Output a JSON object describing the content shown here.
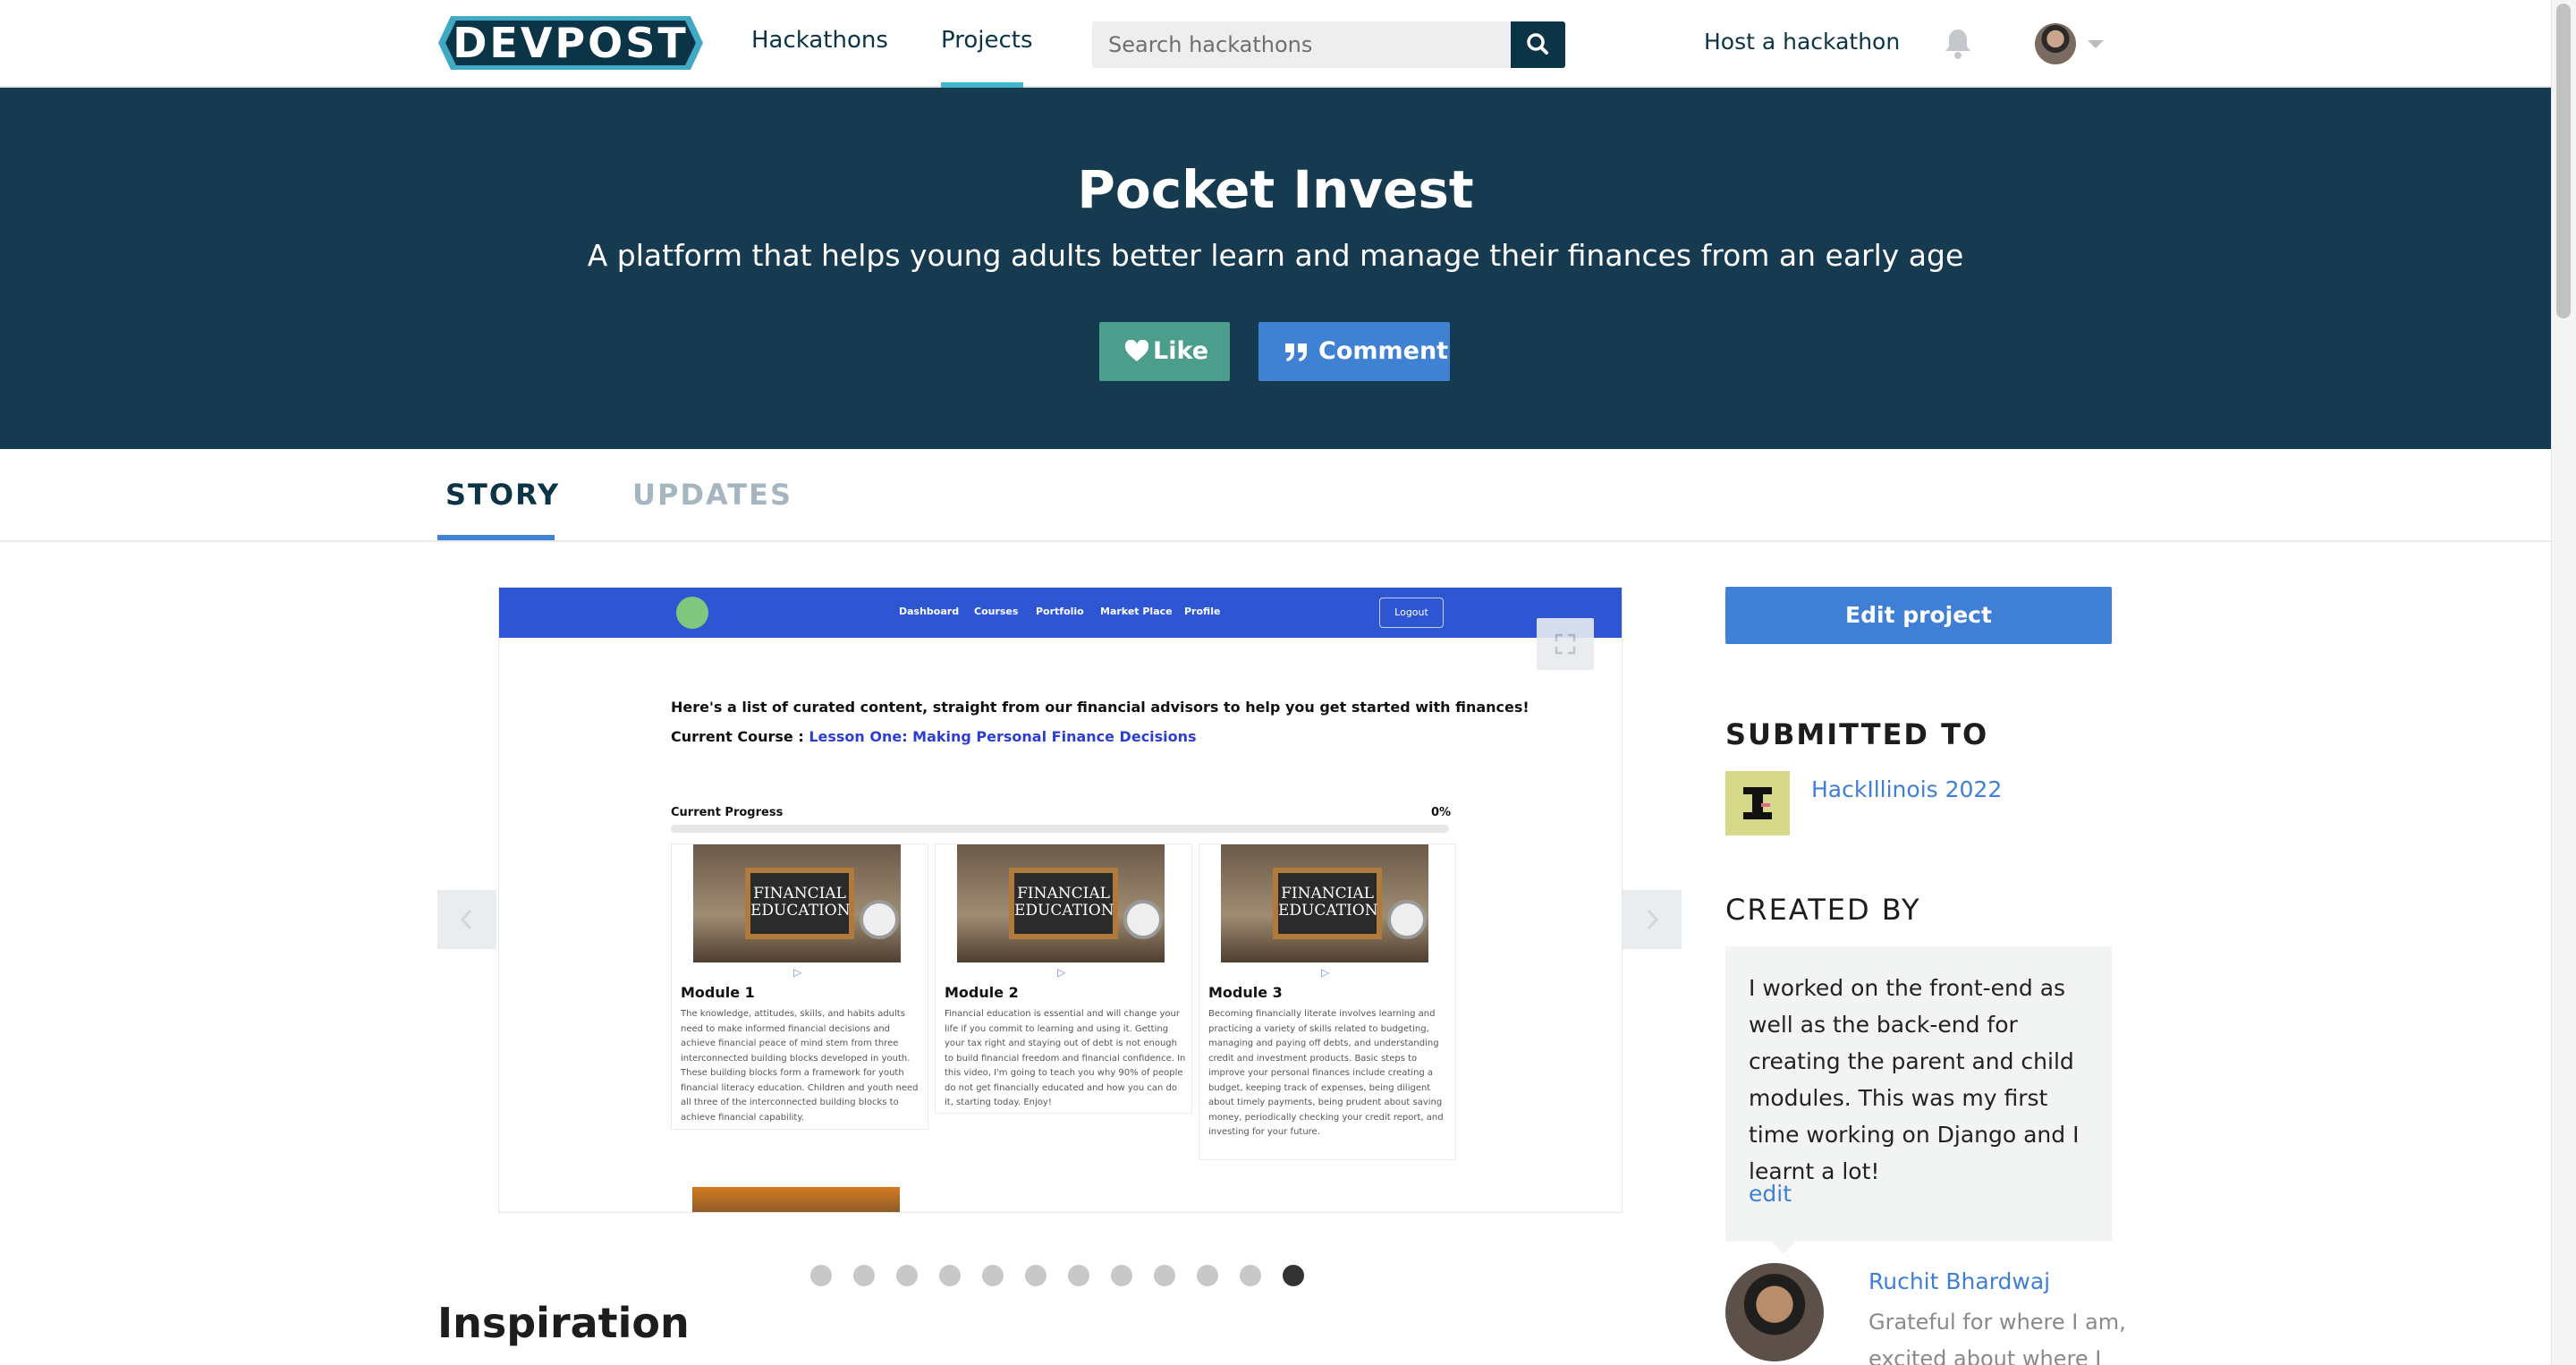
{
  "nav": {
    "logo": "DEVPOST",
    "links": [
      "Hackathons",
      "Projects"
    ],
    "search_placeholder": "Search hackathons",
    "host_label": "Host a hackathon"
  },
  "project": {
    "title": "Pocket Invest",
    "tagline": "A platform that helps young adults better learn and manage their finances from an early age",
    "like_label": "Like",
    "comment_label": "Comment"
  },
  "tabs": [
    "STORY",
    "UPDATES"
  ],
  "gallery": {
    "nav_links": [
      "Dashboard",
      "Courses",
      "Portfolio",
      "Market Place",
      "Profile"
    ],
    "logout_label": "Logout",
    "intro": "Here's a list of curated content, straight from our financial advisors to help you get started with finances!",
    "course_prefix": "Current Course : ",
    "course_link": "Lesson One: Making Personal Finance Decisions",
    "progress_label": "Current Progress",
    "progress_value": "0%",
    "progress_fraction": 0,
    "board_text": "FINANCIAL EDUCATION",
    "modules": [
      {
        "title": "Module 1",
        "text": "The knowledge, attitudes, skills, and habits adults need to make informed financial decisions and achieve financial peace of mind stem from three interconnected building blocks developed in youth. These building blocks form a framework for youth financial literacy education. Children and youth need all three of the interconnected building blocks to achieve financial capability."
      },
      {
        "title": "Module 2",
        "text": "Financial education is essential and will change your life if you commit to learning and using it. Getting your tax right and staying out of debt is not enough to build financial freedom and financial confidence. In this video, I'm going to teach you why 90% of people do not get financially educated and how you can do it, starting today. Enjoy!"
      },
      {
        "title": "Module 3",
        "text": "Becoming financially literate involves learning and practicing a variety of skills related to budgeting, managing and paying off debts, and understanding credit and investment products. Basic steps to improve your personal finances include creating a budget, keeping track of expenses, being diligent about timely payments, being prudent about saving money, periodically checking your credit report, and investing for your future."
      }
    ],
    "slide_count": 12,
    "active_slide": 11
  },
  "section_heading": "Inspiration",
  "sidebar": {
    "edit_label": "Edit project",
    "submitted_heading": "SUBMITTED TO",
    "hackathon": "HackIllinois 2022",
    "created_heading": "CREATED BY",
    "contribution": "I worked on the front-end as well as the back-end for creating the parent and child modules. This was my first time working on Django and I learnt a lot!",
    "edit_link": "edit",
    "creator_name": "Ruchit Bhardwaj",
    "creator_bio": "Grateful for where I am, excited about where I am"
  },
  "colors": {
    "brand_dark": "#163a4f",
    "accent_blue": "#3f7fd6",
    "like_green": "#4a9e8b"
  }
}
